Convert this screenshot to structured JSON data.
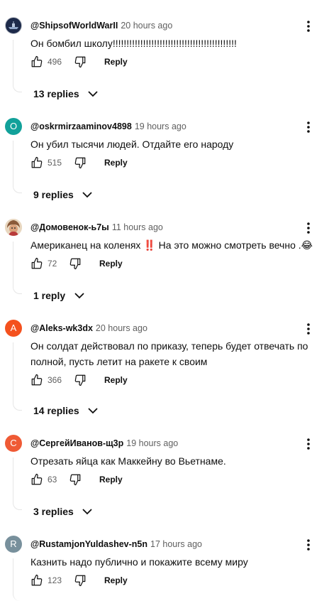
{
  "comments": [
    {
      "author": "@ShipsofWorldWarII",
      "time": "20 hours ago",
      "text": "Он бомбил школу!!!!!!!!!!!!!!!!!!!!!!!!!!!!!!!!!!!!!!!!!!!!!",
      "likes": "496",
      "reply_label": "Reply",
      "replies_label": "13 replies",
      "avatar_letter": "",
      "avatar_color": "#1d2a4a"
    },
    {
      "author": "@oskrmirzaaminov4898",
      "time": "19 hours ago",
      "text": "Он убил тысячи людей. Отдайте его народу",
      "likes": "515",
      "reply_label": "Reply",
      "replies_label": "9 replies",
      "avatar_letter": "O",
      "avatar_color": "#12a19a"
    },
    {
      "author": "@Домовенок-ь7ы",
      "time": "11 hours ago",
      "text_main": "Американец на коленях ",
      "text_mark": "‼️",
      "text_tail": " На это можно смотреть вечно .",
      "text_emoji": "😂",
      "likes": "72",
      "reply_label": "Reply",
      "replies_label": "1 reply",
      "avatar_letter": "",
      "avatar_color": "#c9a880"
    },
    {
      "author": "@Aleks-wk3dx",
      "time": "20 hours ago",
      "text": "Он солдат действовал по приказу, теперь будет отвечать по полной, пусть летит на ракете к своим",
      "likes": "366",
      "reply_label": "Reply",
      "replies_label": "14 replies",
      "avatar_letter": "A",
      "avatar_color": "#f4511e"
    },
    {
      "author": "@СергейИванов-щ3р",
      "time": "19 hours ago",
      "text": "Отрезать яйца как Маккейну во Вьетнаме.",
      "likes": "63",
      "reply_label": "Reply",
      "replies_label": "3 replies",
      "avatar_letter": "С",
      "avatar_color": "#ef5a35"
    },
    {
      "author": "@RustamjonYuldashev-n5n",
      "time": "17 hours ago",
      "text": "Казнить надо публично и покажите всему миру",
      "likes": "123",
      "reply_label": "Reply",
      "avatar_letter": "R",
      "avatar_color": "#78909c"
    }
  ],
  "icons": {
    "like": "thumb-up-icon",
    "dislike": "thumb-down-icon",
    "more": "more-vert-icon",
    "expand": "chevron-down-icon"
  }
}
